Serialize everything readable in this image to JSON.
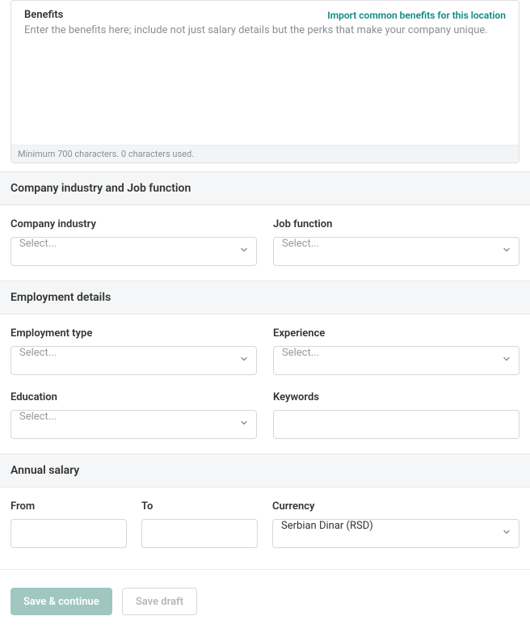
{
  "benefits": {
    "title": "Benefits",
    "import_link": "Import common benefits for this location",
    "placeholder": "Enter the benefits here; include not just salary details but the perks that make your company unique.",
    "char_counter": "Minimum 700 characters. 0 characters used."
  },
  "sections": {
    "industry_function": {
      "header": "Company industry and Job function",
      "company_industry": {
        "label": "Company industry",
        "value": "Select..."
      },
      "job_function": {
        "label": "Job function",
        "value": "Select..."
      }
    },
    "employment": {
      "header": "Employment details",
      "employment_type": {
        "label": "Employment type",
        "value": "Select..."
      },
      "experience": {
        "label": "Experience",
        "value": "Select..."
      },
      "education": {
        "label": "Education",
        "value": "Select..."
      },
      "keywords": {
        "label": "Keywords",
        "value": ""
      }
    },
    "salary": {
      "header": "Annual salary",
      "from": {
        "label": "From",
        "value": ""
      },
      "to": {
        "label": "To",
        "value": ""
      },
      "currency": {
        "label": "Currency",
        "value": "Serbian Dinar (RSD)"
      }
    }
  },
  "buttons": {
    "primary": "Save & continue",
    "secondary": "Save draft"
  }
}
